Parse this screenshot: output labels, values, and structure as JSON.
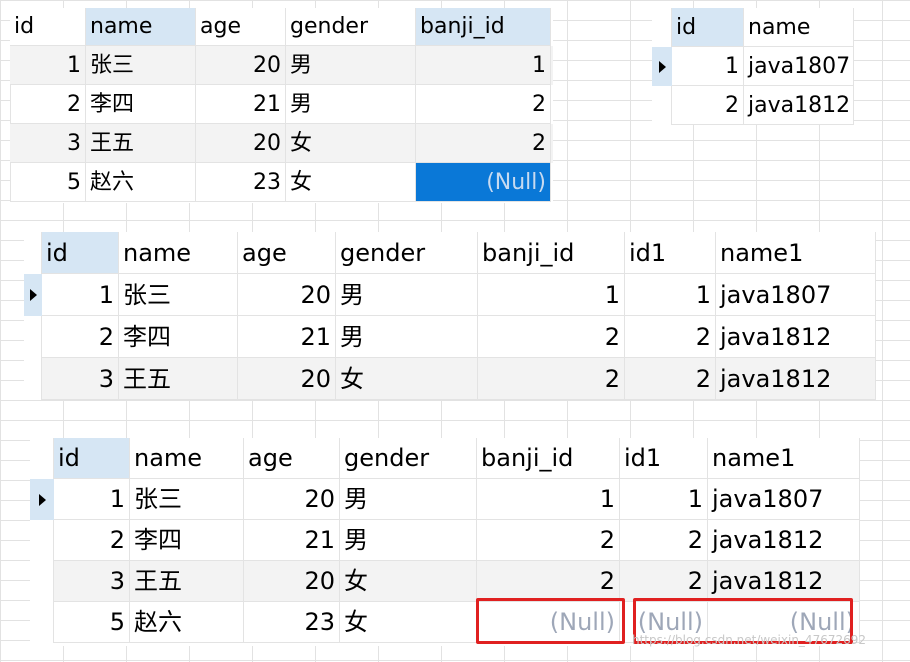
{
  "grid_a": {
    "columns": [
      "id",
      "name",
      "age",
      "gender",
      "banji_id"
    ],
    "rows": [
      [
        "1",
        "张三",
        "20",
        "男",
        "1"
      ],
      [
        "2",
        "李四",
        "21",
        "男",
        "2"
      ],
      [
        "3",
        "王五",
        "20",
        "女",
        "2"
      ],
      [
        "5",
        "赵六",
        "23",
        "女",
        "(Null)"
      ]
    ]
  },
  "grid_b": {
    "columns": [
      "id",
      "name"
    ],
    "rows": [
      [
        "1",
        "java1807"
      ],
      [
        "2",
        "java1812"
      ]
    ]
  },
  "grid_c": {
    "columns": [
      "id",
      "name",
      "age",
      "gender",
      "banji_id",
      "id1",
      "name1"
    ],
    "rows": [
      [
        "1",
        "张三",
        "20",
        "男",
        "1",
        "1",
        "java1807"
      ],
      [
        "2",
        "李四",
        "21",
        "男",
        "2",
        "2",
        "java1812"
      ],
      [
        "3",
        "王五",
        "20",
        "女",
        "2",
        "2",
        "java1812"
      ]
    ]
  },
  "grid_d": {
    "columns": [
      "id",
      "name",
      "age",
      "gender",
      "banji_id",
      "id1",
      "name1"
    ],
    "rows": [
      [
        "1",
        "张三",
        "20",
        "男",
        "1",
        "1",
        "java1807"
      ],
      [
        "2",
        "李四",
        "21",
        "男",
        "2",
        "2",
        "java1812"
      ],
      [
        "3",
        "王五",
        "20",
        "女",
        "2",
        "2",
        "java1812"
      ],
      [
        "5",
        "赵六",
        "23",
        "女",
        "(Null)",
        "(Null)",
        "(Null)"
      ]
    ]
  },
  "watermark": "https://blog.csdn.net/weixin_47672692",
  "colors": {
    "selected_header": "#d6e6f4",
    "selected_cell": "#0a78d7",
    "null_text": "#9ea7b8",
    "highlight_box": "#e02020"
  }
}
